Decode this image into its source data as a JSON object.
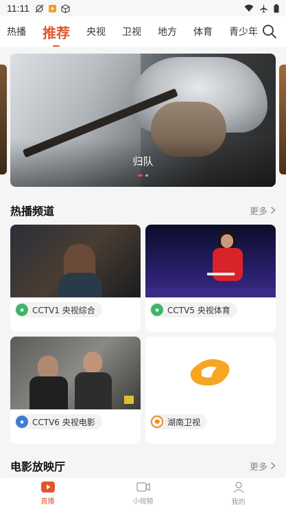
{
  "status_bar": {
    "time": "11:11"
  },
  "top_nav": {
    "tabs": [
      {
        "label": "热播"
      },
      {
        "label": "推荐"
      },
      {
        "label": "央视"
      },
      {
        "label": "卫视"
      },
      {
        "label": "地方"
      },
      {
        "label": "体育"
      },
      {
        "label": "青少年"
      }
    ],
    "active_tab": "推荐"
  },
  "banner": {
    "title": "归队",
    "slide_count": 2,
    "active_slide": 1
  },
  "hot_channels": {
    "title": "热播频道",
    "more_label": "更多",
    "channels": [
      {
        "name": "CCTV1 央视综合",
        "logo_color": "#3db66b"
      },
      {
        "name": "CCTV5 央视体育",
        "logo_color": "#3db66b"
      },
      {
        "name": "CCTV6 央视电影",
        "logo_color": "#3d7cd6"
      },
      {
        "name": "湖南卫视",
        "logo_color": "#f08a1e"
      }
    ]
  },
  "cinema": {
    "title": "电影放映厅",
    "more_label": "更多"
  },
  "bottom_nav": {
    "items": [
      {
        "label": "直播"
      },
      {
        "label": "小视频"
      },
      {
        "label": "我的"
      }
    ]
  },
  "colors": {
    "accent": "#e2562b"
  }
}
